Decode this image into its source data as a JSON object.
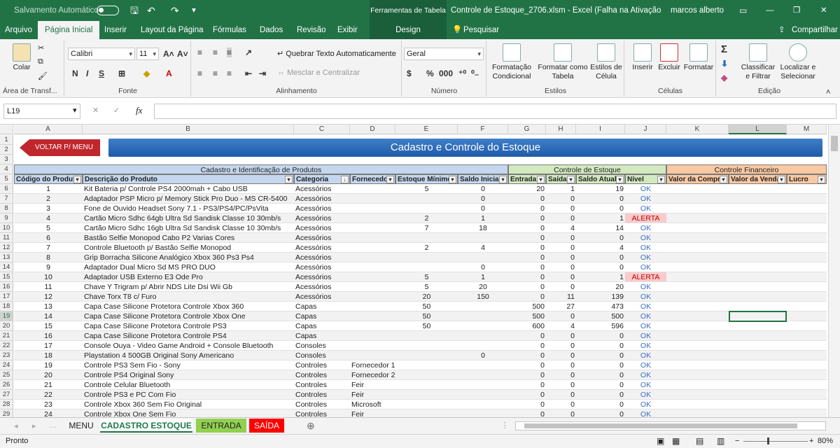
{
  "titlebar": {
    "autosave": "Salvamento Automático",
    "context_tab": "Ferramentas de Tabela",
    "doc_title": "Controle de Estoque_2706.xlsm  -  Excel (Falha na Ativação do P...",
    "user": "marcos alberto",
    "minimize": "—",
    "restore": "❐",
    "close": "✕"
  },
  "tabs": [
    "Arquivo",
    "Página Inicial",
    "Inserir",
    "Layout da Página",
    "Fórmulas",
    "Dados",
    "Revisão",
    "Exibir",
    "Design"
  ],
  "tell_me": "Pesquisar",
  "share": "Compartilhar",
  "ribbon": {
    "clipboard": {
      "paste": "Colar",
      "label": "Área de Transf..."
    },
    "font": {
      "name": "Calibri",
      "size": "11",
      "bold": "N",
      "italic": "I",
      "underline": "S",
      "label": "Fonte"
    },
    "alignment": {
      "wrap": "Quebrar Texto Automaticamente",
      "merge": "Mesclar e Centralizar",
      "label": "Alinhamento"
    },
    "number": {
      "format": "Geral",
      "currency": "$",
      "percent": "%",
      "thousands": "000",
      "label": "Número"
    },
    "styles": {
      "conditional": "Formatação Condicional",
      "table": "Formatar como Tabela",
      "cell": "Estilos de Célula",
      "label": "Estilos"
    },
    "cells": {
      "insert": "Inserir",
      "delete": "Excluir",
      "format": "Formatar",
      "label": "Células"
    },
    "editing": {
      "sort": "Classificar e Filtrar",
      "find": "Localizar e Selecionar",
      "label": "Edição"
    }
  },
  "formula": {
    "namebox": "L19",
    "fx": "fx",
    "value": ""
  },
  "columns": [
    "A",
    "B",
    "C",
    "D",
    "E",
    "F",
    "G",
    "H",
    "I",
    "J",
    "K",
    "L",
    "M"
  ],
  "sheet": {
    "back_button": "VOLTAR P/ MENU",
    "banner": "Cadastro e Controle do Estoque",
    "section1": "Cadastro e Identificação de Produtos",
    "section2": "Controle de Estoque",
    "section3": "Controle Financeiro",
    "headers": [
      "Código do Produto",
      "Descrição do Produto",
      "Categoria",
      "Fornecedor",
      "Estoque Mínimo",
      "Saldo Inicial",
      "Entrada",
      "Saída",
      "Saldo Atual",
      "Nível",
      "Valor da Compra",
      "Valor da Venda",
      "Lucro"
    ],
    "rows": [
      [
        "1",
        "Kit Bateria p/ Controle PS4 2000mah + Cabo USB",
        "Acessórios",
        "",
        "5",
        "0",
        "20",
        "1",
        "19",
        "OK"
      ],
      [
        "2",
        "Adaptador PSP Micro p/ Memory Stick Pro Duo - MS CR-5400",
        "Acessórios",
        "",
        "",
        "0",
        "0",
        "0",
        "0",
        "OK"
      ],
      [
        "3",
        "Fone de Ouvido Headset Sony 7.1 - PS3/PS4/PC/PsVita",
        "Acessórios",
        "",
        "",
        "0",
        "0",
        "0",
        "0",
        "OK"
      ],
      [
        "4",
        "Cartão Micro Sdhc 64gb Ultra Sd Sandisk Classe 10  30mb/s",
        "Acessórios",
        "",
        "2",
        "1",
        "0",
        "0",
        "1",
        "ALERTA"
      ],
      [
        "5",
        "Cartão Micro Sdhc 16gb Ultra Sd Sandisk Classe 10  30mb/s",
        "Acessórios",
        "",
        "7",
        "18",
        "0",
        "4",
        "14",
        "OK"
      ],
      [
        "6",
        "Bastão Selfie Monopod Cabo P2 Varias Cores",
        "Acessórios",
        "",
        "",
        "",
        "0",
        "0",
        "0",
        "OK"
      ],
      [
        "7",
        "Controle Bluetooth p/ Bastão Selfie Monopod",
        "Acessórios",
        "",
        "2",
        "4",
        "0",
        "0",
        "4",
        "OK"
      ],
      [
        "8",
        "Grip Borracha Silicone Analógico Xbox 360 Ps3 Ps4",
        "Acessórios",
        "",
        "",
        "",
        "0",
        "0",
        "0",
        "OK"
      ],
      [
        "9",
        "Adaptador Dual Micro Sd MS PRO DUO",
        "Acessórios",
        "",
        "",
        "0",
        "0",
        "0",
        "0",
        "OK"
      ],
      [
        "10",
        "Adaptador USB Externo E3 Ode Pro",
        "Acessórios",
        "",
        "5",
        "1",
        "0",
        "0",
        "1",
        "ALERTA"
      ],
      [
        "11",
        "Chave Y Trigram p/ Abrir NDS Lite Dsi Wii Gb",
        "Acessórios",
        "",
        "5",
        "20",
        "0",
        "0",
        "20",
        "OK"
      ],
      [
        "12",
        "Chave Torx T8 c/ Furo",
        "Acessórios",
        "",
        "20",
        "150",
        "0",
        "11",
        "139",
        "OK"
      ],
      [
        "13",
        "Capa Case Silicone Protetora Controle Xbox 360",
        "Capas",
        "",
        "50",
        "",
        "500",
        "27",
        "473",
        "OK"
      ],
      [
        "14",
        "Capa Case Silicone Protetora Controle Xbox One",
        "Capas",
        "",
        "50",
        "",
        "500",
        "0",
        "500",
        "OK"
      ],
      [
        "15",
        "Capa Case Silicone Protetora Controle PS3",
        "Capas",
        "",
        "50",
        "",
        "600",
        "4",
        "596",
        "OK"
      ],
      [
        "16",
        "Capa Case Silicone Protetora Controle PS4",
        "Capas",
        "",
        "",
        "",
        "0",
        "0",
        "0",
        "OK"
      ],
      [
        "17",
        "Console Ouya - Video Game Android + Console Bluetooth",
        "Consoles",
        "",
        "",
        "",
        "0",
        "0",
        "0",
        "OK"
      ],
      [
        "18",
        "Playstation 4 500GB Original Sony Americano",
        "Consoles",
        "",
        "",
        "0",
        "0",
        "0",
        "0",
        "OK"
      ],
      [
        "19",
        "Controle PS3 Sem Fio - Sony",
        "Controles",
        "Fornecedor 1",
        "",
        "",
        "0",
        "0",
        "0",
        "OK"
      ],
      [
        "20",
        "Controle PS4 Original Sony",
        "Controles",
        "Fornecedor 2",
        "",
        "",
        "0",
        "0",
        "0",
        "OK"
      ],
      [
        "21",
        "Controle Celular Bluetooth",
        "Controles",
        "Feir",
        "",
        "",
        "0",
        "0",
        "0",
        "OK"
      ],
      [
        "22",
        "Controle PS3 e PC Com Fio",
        "Controles",
        "Feir",
        "",
        "",
        "0",
        "0",
        "0",
        "OK"
      ],
      [
        "23",
        "Controle Xbox 360 Sem Fio Original",
        "Controles",
        "Microsoft",
        "",
        "",
        "0",
        "0",
        "0",
        "OK"
      ],
      [
        "24",
        "Controle Xbox One Sem Fio",
        "Controles",
        "Feir",
        "",
        "",
        "0",
        "0",
        "0",
        "OK"
      ]
    ]
  },
  "sheettabs": [
    "MENU",
    "CADASTRO ESTOQUE",
    "ENTRADA",
    "SAÍDA"
  ],
  "status": {
    "ready": "Pronto",
    "zoom": "80%"
  }
}
